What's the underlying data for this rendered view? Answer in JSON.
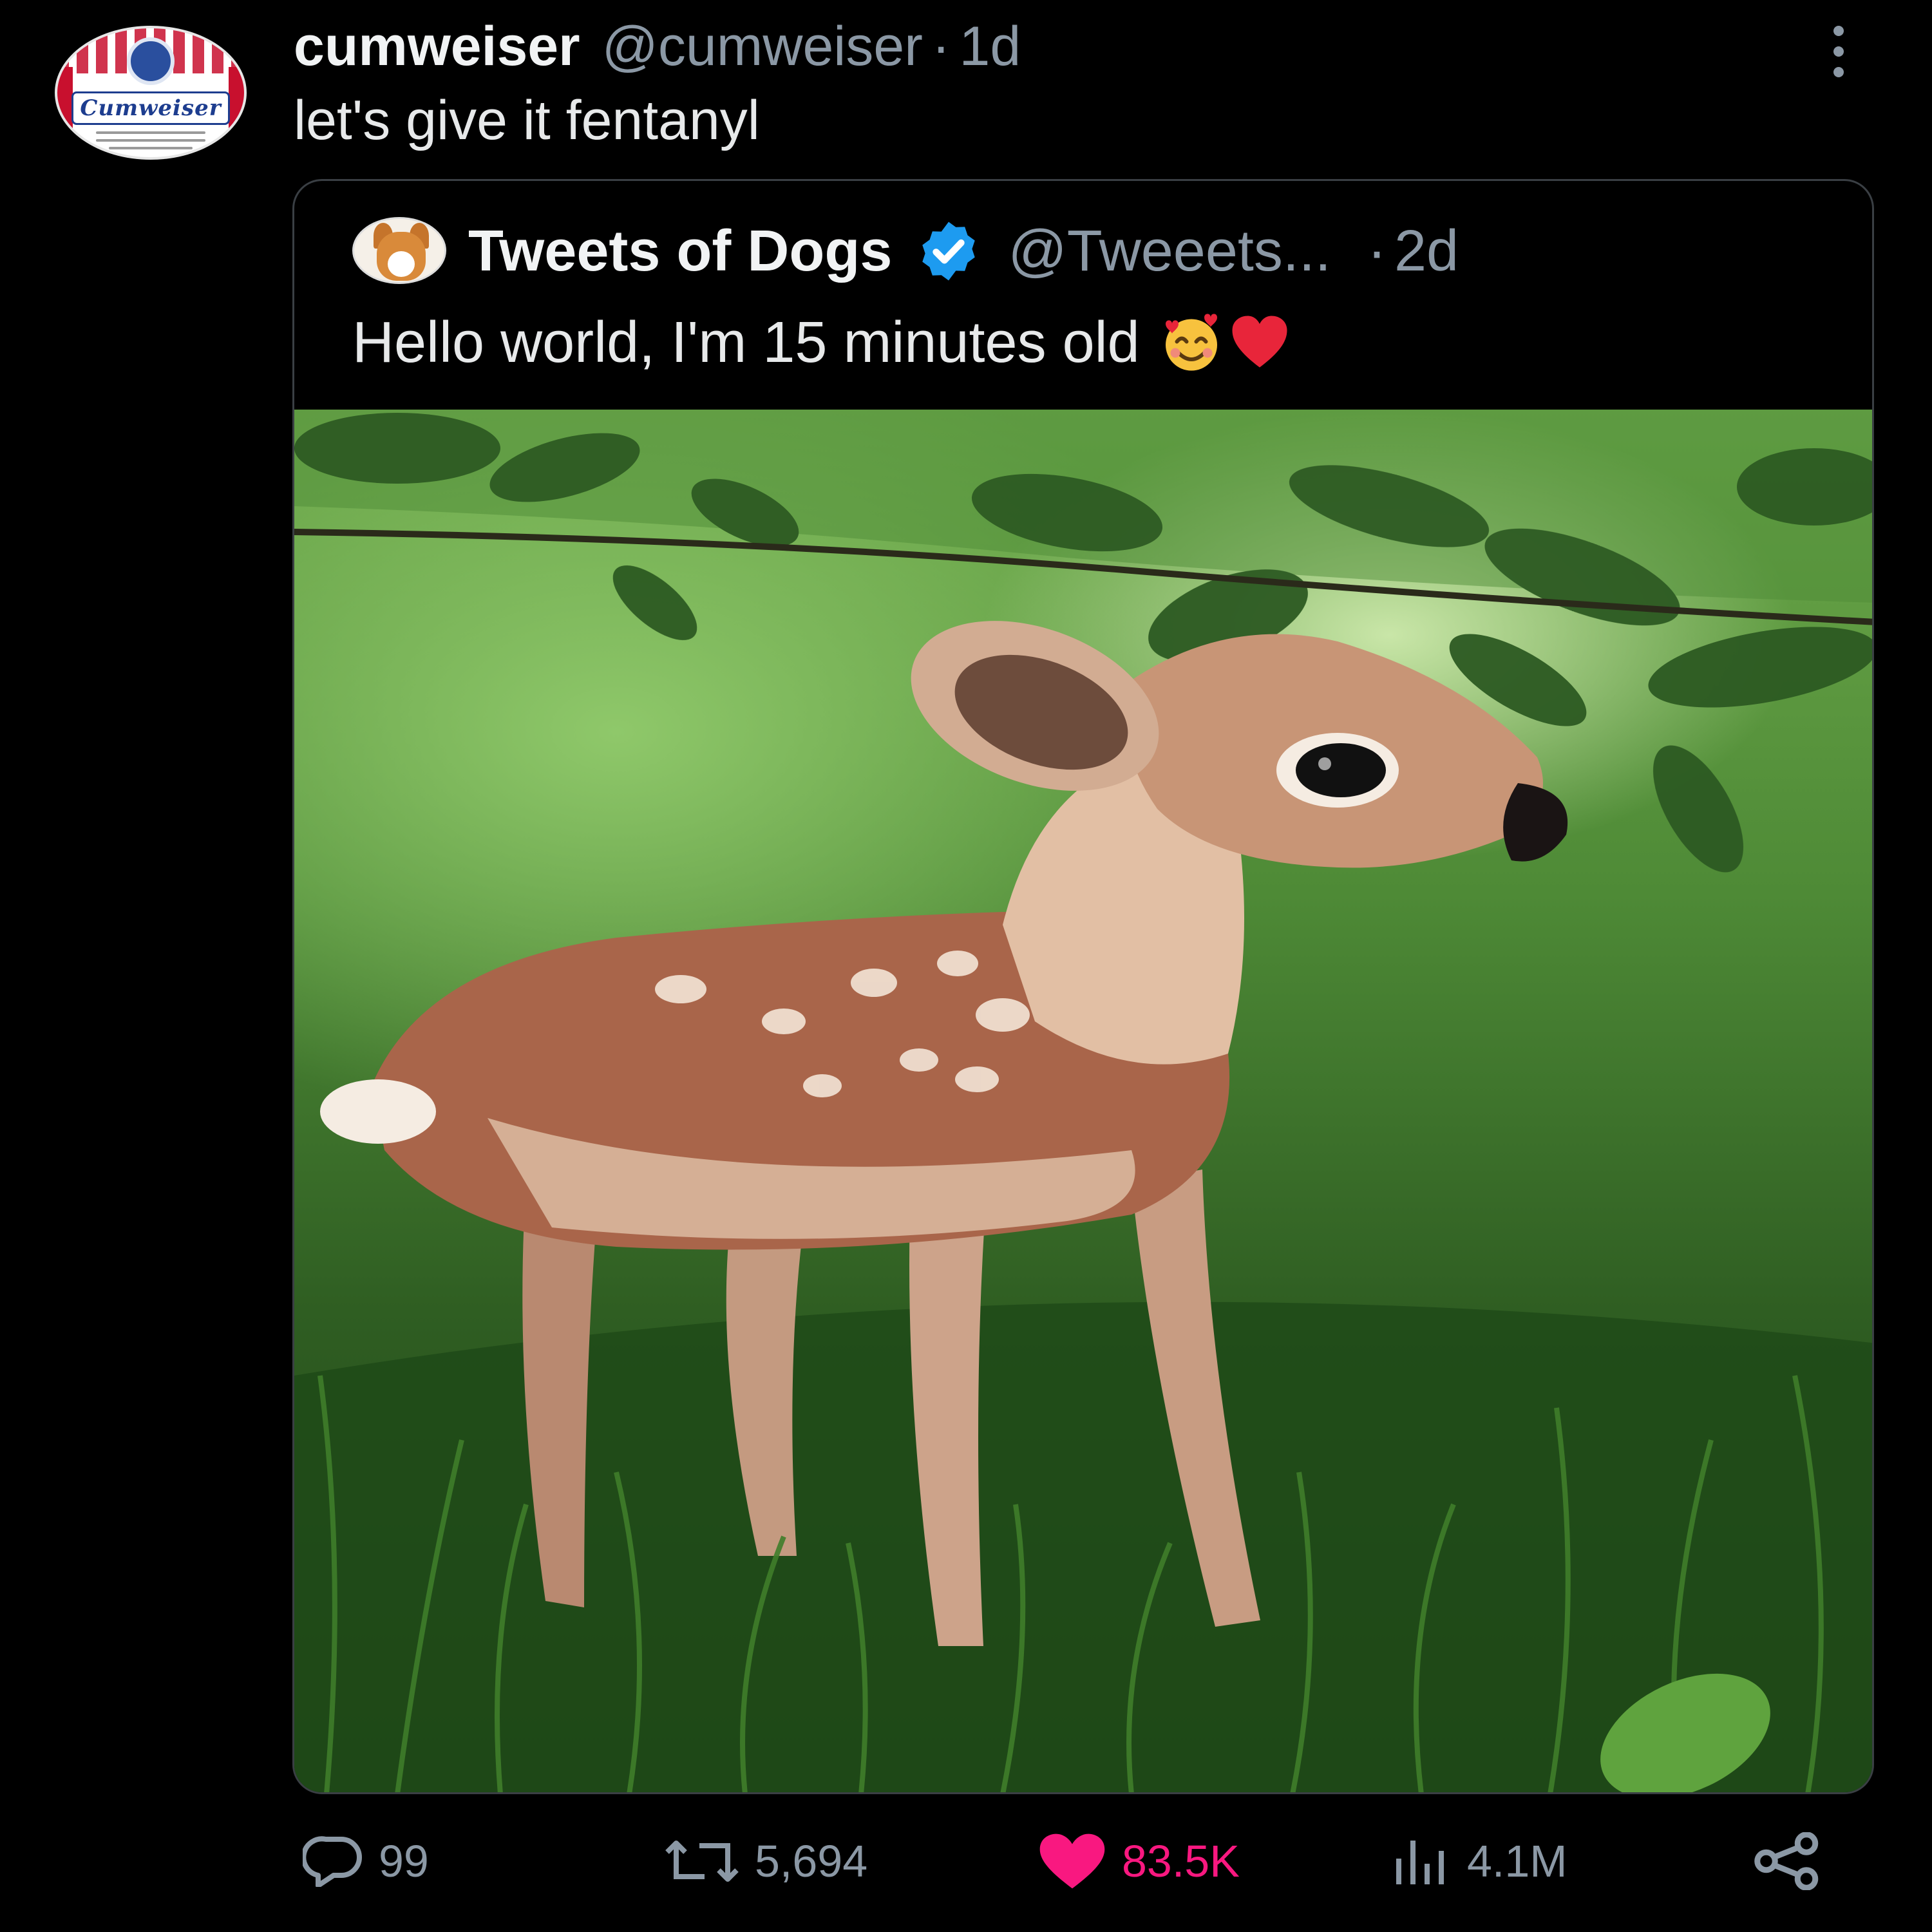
{
  "tweet": {
    "display_name": "cumweiser",
    "handle": "@cumweiser",
    "separator": "·",
    "time": "1d",
    "text": "let's give it fentanyl",
    "avatar_wordmark": "Cumweiser"
  },
  "quoted": {
    "display_name": "Tweets of Dogs",
    "handle": "@Tweeets...",
    "separator": "·",
    "time": "2d",
    "text": "Hello world, I'm 15 minutes old",
    "emojis": [
      "smiling-face-with-hearts-icon",
      "red-heart-icon"
    ],
    "verified": true
  },
  "actions": {
    "replies": "99",
    "retweets": "5,694",
    "likes": "83.5K",
    "views": "4.1M"
  },
  "colors": {
    "background": "#000000",
    "muted": "#8b98a5",
    "like": "#f91880",
    "verified": "#1d9bf0"
  }
}
